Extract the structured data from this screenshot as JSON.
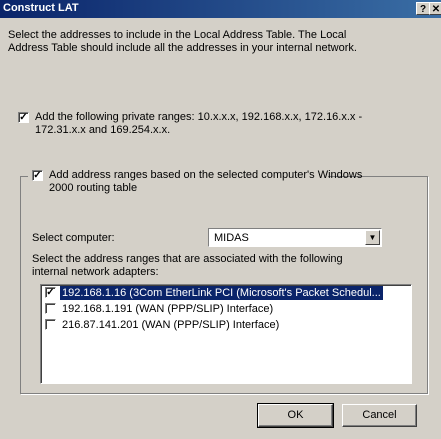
{
  "window": {
    "title": "Construct LAT",
    "help_label": "?",
    "close_label": "✕"
  },
  "intro": {
    "line1": "Select the addresses to include in the Local Address Table. The Local",
    "line2": "Address Table should include all the addresses in your internal network."
  },
  "private_ranges": {
    "checked": true,
    "line1": "Add the following private ranges: 10.x.x.x, 192.168.x.x, 172.16.x.x -",
    "line2": "172.31.x.x and 169.254.x.x."
  },
  "routing_ranges": {
    "checked": true,
    "line1": "Add address ranges based on the selected computer's Windows",
    "line2": "2000 routing table"
  },
  "select_computer": {
    "label": "Select computer:",
    "value": "MIDAS"
  },
  "adapters": {
    "line1": "Select the address ranges that are associated with the following",
    "line2": "internal network adapters:",
    "items": [
      {
        "label": "192.168.1.16 (3Com EtherLink PCI (Microsoft's Packet Schedul...",
        "checked": true,
        "selected": true
      },
      {
        "label": "192.168.1.191 (WAN (PPP/SLIP) Interface)",
        "checked": false,
        "selected": false
      },
      {
        "label": "216.87.141.201 (WAN (PPP/SLIP) Interface)",
        "checked": false,
        "selected": false
      }
    ]
  },
  "buttons": {
    "ok": "OK",
    "cancel": "Cancel"
  },
  "colors": {
    "titlebar": "#0a246a",
    "dialog_bg": "#d4d0c8",
    "selection": "#0a246a"
  }
}
